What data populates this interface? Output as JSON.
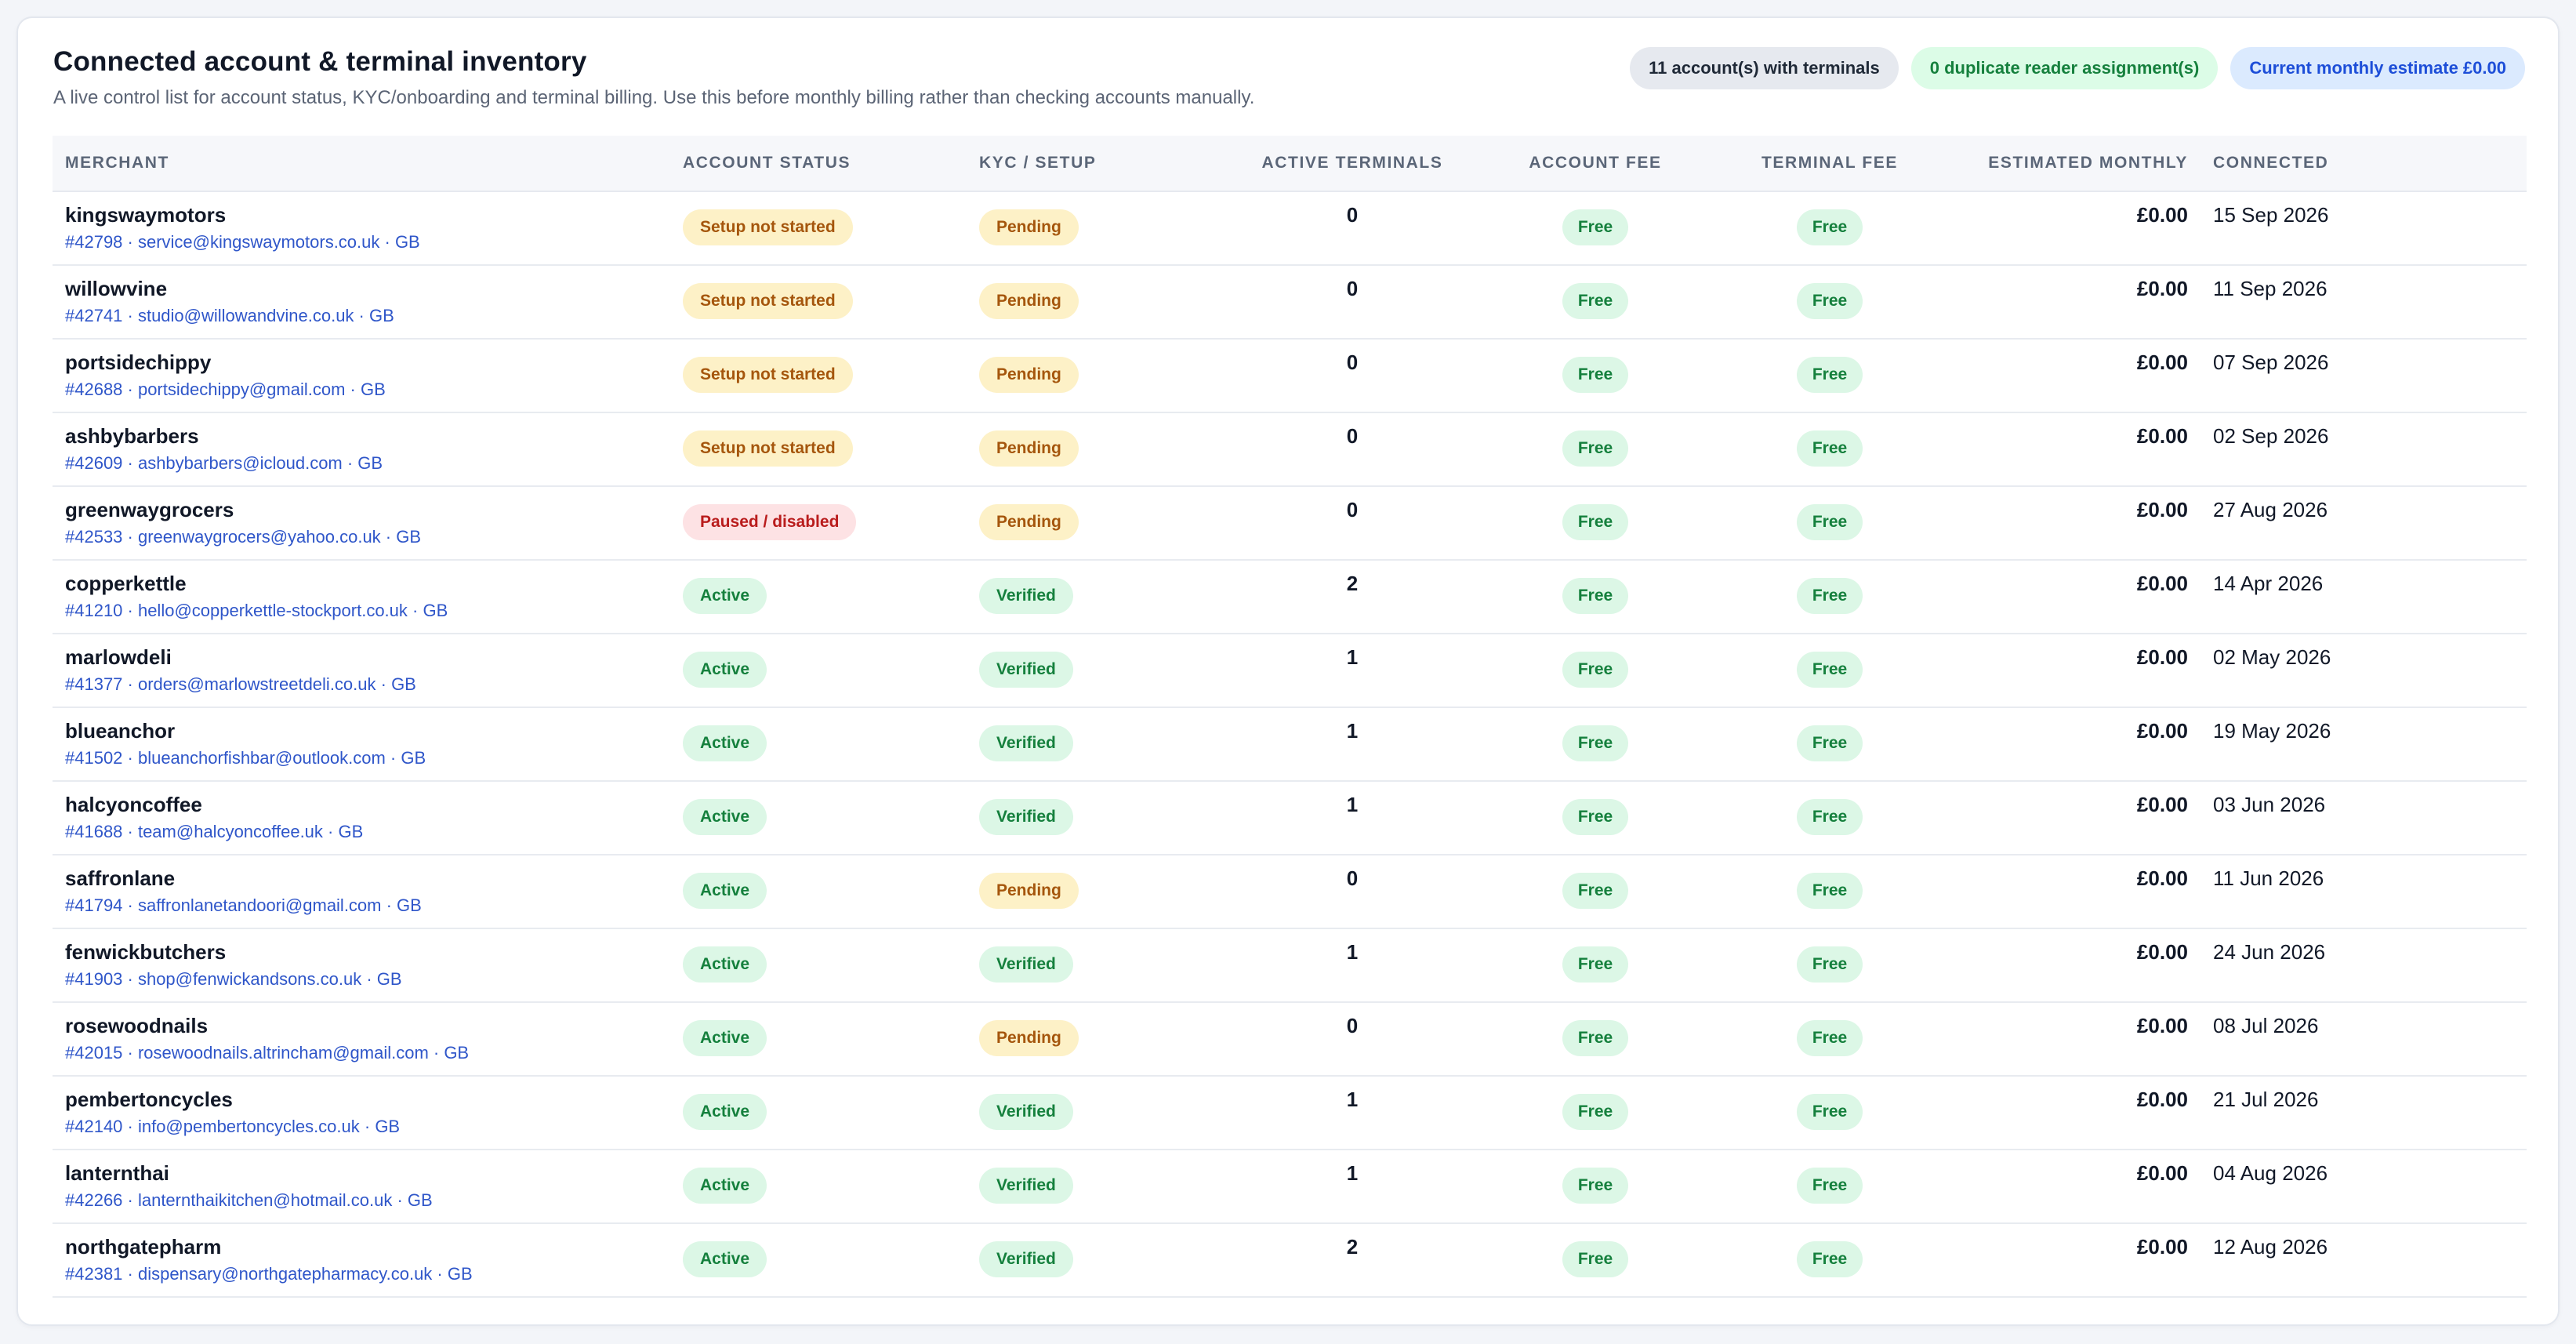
{
  "header": {
    "title": "Connected account & terminal inventory",
    "subtitle": "A live control list for account status, KYC/onboarding and terminal billing. Use this before monthly billing rather than checking accounts manually.",
    "pills": [
      {
        "label": "11 account(s) with terminals",
        "tone": "gray"
      },
      {
        "label": "0 duplicate reader assignment(s)",
        "tone": "green"
      },
      {
        "label": "Current monthly estimate £0.00",
        "tone": "blue"
      }
    ]
  },
  "table": {
    "columns": [
      "Merchant",
      "Account status",
      "KYC / setup",
      "Active terminals",
      "Account fee",
      "Terminal fee",
      "Estimated monthly",
      "Connected"
    ],
    "rows": [
      {
        "name": "kingswaymotors",
        "meta": "#42798 · service@kingswaymotors.co.uk · GB",
        "status": "Setup not started",
        "status_tone": "amber",
        "kyc": "Pending",
        "kyc_tone": "amber",
        "terminals": "0",
        "account_fee": "Free",
        "terminal_fee": "Free",
        "estimate": "£0.00",
        "connected": "15 Sep 2026"
      },
      {
        "name": "willowvine",
        "meta": "#42741 · studio@willowandvine.co.uk · GB",
        "status": "Setup not started",
        "status_tone": "amber",
        "kyc": "Pending",
        "kyc_tone": "amber",
        "terminals": "0",
        "account_fee": "Free",
        "terminal_fee": "Free",
        "estimate": "£0.00",
        "connected": "11 Sep 2026"
      },
      {
        "name": "portsidechippy",
        "meta": "#42688 · portsidechippy@gmail.com · GB",
        "status": "Setup not started",
        "status_tone": "amber",
        "kyc": "Pending",
        "kyc_tone": "amber",
        "terminals": "0",
        "account_fee": "Free",
        "terminal_fee": "Free",
        "estimate": "£0.00",
        "connected": "07 Sep 2026"
      },
      {
        "name": "ashbybarbers",
        "meta": "#42609 · ashbybarbers@icloud.com · GB",
        "status": "Setup not started",
        "status_tone": "amber",
        "kyc": "Pending",
        "kyc_tone": "amber",
        "terminals": "0",
        "account_fee": "Free",
        "terminal_fee": "Free",
        "estimate": "£0.00",
        "connected": "02 Sep 2026"
      },
      {
        "name": "greenwaygrocers",
        "meta": "#42533 · greenwaygrocers@yahoo.co.uk · GB",
        "status": "Paused / disabled",
        "status_tone": "red",
        "kyc": "Pending",
        "kyc_tone": "amber",
        "terminals": "0",
        "account_fee": "Free",
        "terminal_fee": "Free",
        "estimate": "£0.00",
        "connected": "27 Aug 2026"
      },
      {
        "name": "copperkettle",
        "meta": "#41210 · hello@copperkettle-stockport.co.uk · GB",
        "status": "Active",
        "status_tone": "green",
        "kyc": "Verified",
        "kyc_tone": "green",
        "terminals": "2",
        "account_fee": "Free",
        "terminal_fee": "Free",
        "estimate": "£0.00",
        "connected": "14 Apr 2026"
      },
      {
        "name": "marlowdeli",
        "meta": "#41377 · orders@marlowstreetdeli.co.uk · GB",
        "status": "Active",
        "status_tone": "green",
        "kyc": "Verified",
        "kyc_tone": "green",
        "terminals": "1",
        "account_fee": "Free",
        "terminal_fee": "Free",
        "estimate": "£0.00",
        "connected": "02 May 2026"
      },
      {
        "name": "blueanchor",
        "meta": "#41502 · blueanchorfishbar@outlook.com · GB",
        "status": "Active",
        "status_tone": "green",
        "kyc": "Verified",
        "kyc_tone": "green",
        "terminals": "1",
        "account_fee": "Free",
        "terminal_fee": "Free",
        "estimate": "£0.00",
        "connected": "19 May 2026"
      },
      {
        "name": "halcyoncoffee",
        "meta": "#41688 · team@halcyoncoffee.uk · GB",
        "status": "Active",
        "status_tone": "green",
        "kyc": "Verified",
        "kyc_tone": "green",
        "terminals": "1",
        "account_fee": "Free",
        "terminal_fee": "Free",
        "estimate": "£0.00",
        "connected": "03 Jun 2026"
      },
      {
        "name": "saffronlane",
        "meta": "#41794 · saffronlanetandoori@gmail.com · GB",
        "status": "Active",
        "status_tone": "green",
        "kyc": "Pending",
        "kyc_tone": "amber",
        "terminals": "0",
        "account_fee": "Free",
        "terminal_fee": "Free",
        "estimate": "£0.00",
        "connected": "11 Jun 2026"
      },
      {
        "name": "fenwickbutchers",
        "meta": "#41903 · shop@fenwickandsons.co.uk · GB",
        "status": "Active",
        "status_tone": "green",
        "kyc": "Verified",
        "kyc_tone": "green",
        "terminals": "1",
        "account_fee": "Free",
        "terminal_fee": "Free",
        "estimate": "£0.00",
        "connected": "24 Jun 2026"
      },
      {
        "name": "rosewoodnails",
        "meta": "#42015 · rosewoodnails.altrincham@gmail.com · GB",
        "status": "Active",
        "status_tone": "green",
        "kyc": "Pending",
        "kyc_tone": "amber",
        "terminals": "0",
        "account_fee": "Free",
        "terminal_fee": "Free",
        "estimate": "£0.00",
        "connected": "08 Jul 2026"
      },
      {
        "name": "pembertoncycles",
        "meta": "#42140 · info@pembertoncycles.co.uk · GB",
        "status": "Active",
        "status_tone": "green",
        "kyc": "Verified",
        "kyc_tone": "green",
        "terminals": "1",
        "account_fee": "Free",
        "terminal_fee": "Free",
        "estimate": "£0.00",
        "connected": "21 Jul 2026"
      },
      {
        "name": "lanternthai",
        "meta": "#42266 · lanternthaikitchen@hotmail.co.uk · GB",
        "status": "Active",
        "status_tone": "green",
        "kyc": "Verified",
        "kyc_tone": "green",
        "terminals": "1",
        "account_fee": "Free",
        "terminal_fee": "Free",
        "estimate": "£0.00",
        "connected": "04 Aug 2026"
      },
      {
        "name": "northgatepharm",
        "meta": "#42381 · dispensary@northgatepharmacy.co.uk · GB",
        "status": "Active",
        "status_tone": "green",
        "kyc": "Verified",
        "kyc_tone": "green",
        "terminals": "2",
        "account_fee": "Free",
        "terminal_fee": "Free",
        "estimate": "£0.00",
        "connected": "12 Aug 2026"
      }
    ]
  }
}
